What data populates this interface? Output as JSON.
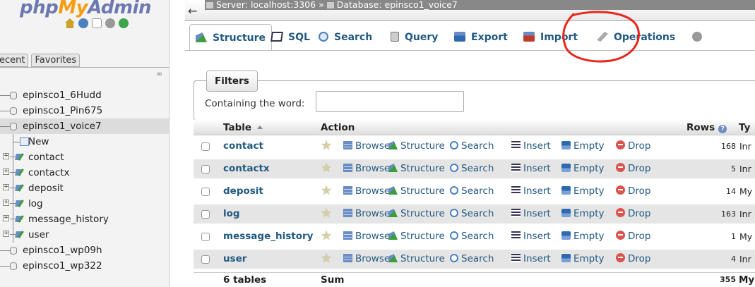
{
  "nav": {
    "logo": {
      "php": "php",
      "my": "My",
      "admin": "Admin"
    },
    "icons": [
      "home-icon",
      "info-icon",
      "documentation-icon",
      "settings-icon",
      "reload-icon"
    ],
    "tabs": [
      "ecent",
      "Favorites"
    ],
    "tree": [
      {
        "label": "epinsco1_6Hudd",
        "level": 0,
        "selected": false
      },
      {
        "label": "epinsco1_Pin675",
        "level": 0,
        "selected": false
      },
      {
        "label": "epinsco1_voice7",
        "level": 0,
        "selected": true
      },
      {
        "label": "New",
        "level": 1,
        "kind": "new"
      },
      {
        "label": "contact",
        "level": 1,
        "kind": "table"
      },
      {
        "label": "contactx",
        "level": 1,
        "kind": "table"
      },
      {
        "label": "deposit",
        "level": 1,
        "kind": "table"
      },
      {
        "label": "log",
        "level": 1,
        "kind": "table"
      },
      {
        "label": "message_history",
        "level": 1,
        "kind": "table"
      },
      {
        "label": "user",
        "level": 1,
        "kind": "table"
      },
      {
        "label": "epinsco1_wp09h",
        "level": 0,
        "selected": false
      },
      {
        "label": "epinsco1_wp322",
        "level": 0,
        "selected": false
      }
    ]
  },
  "breadcrumb": {
    "server": "Server: localhost:3306",
    "separator": "»",
    "database": "Database: epinsco1_voice7"
  },
  "tabs": [
    {
      "label": "Structure",
      "icon": "structure-icon",
      "active": true
    },
    {
      "label": "SQL",
      "icon": "sql-icon"
    },
    {
      "label": "Search",
      "icon": "search-icon"
    },
    {
      "label": "Query",
      "icon": "query-icon"
    },
    {
      "label": "Export",
      "icon": "export-icon"
    },
    {
      "label": "Import",
      "icon": "import-icon"
    },
    {
      "label": "Operations",
      "icon": "wrench-icon"
    },
    {
      "label": "",
      "icon": "more-icon"
    }
  ],
  "annotation_color": "#e8261c",
  "filters": {
    "legend": "Filters",
    "label": "Containing the word:",
    "value": ""
  },
  "table_list": {
    "headers": {
      "table": "Table",
      "action": "Action",
      "rows": "Rows",
      "type": "Ty"
    },
    "actions": [
      "Browse",
      "Structure",
      "Search",
      "Insert",
      "Empty",
      "Drop"
    ],
    "rows": [
      {
        "name": "contact",
        "rows": "168",
        "type": "Inr"
      },
      {
        "name": "contactx",
        "rows": "5",
        "type": "Inr"
      },
      {
        "name": "deposit",
        "rows": "14",
        "type": "My"
      },
      {
        "name": "log",
        "rows": "163",
        "type": "Inr"
      },
      {
        "name": "message_history",
        "rows": "1",
        "type": "My"
      },
      {
        "name": "user",
        "rows": "4",
        "type": "Inr"
      }
    ],
    "footer": {
      "count": "6 tables",
      "sum": "Sum",
      "rows": "355",
      "type": "My"
    }
  }
}
